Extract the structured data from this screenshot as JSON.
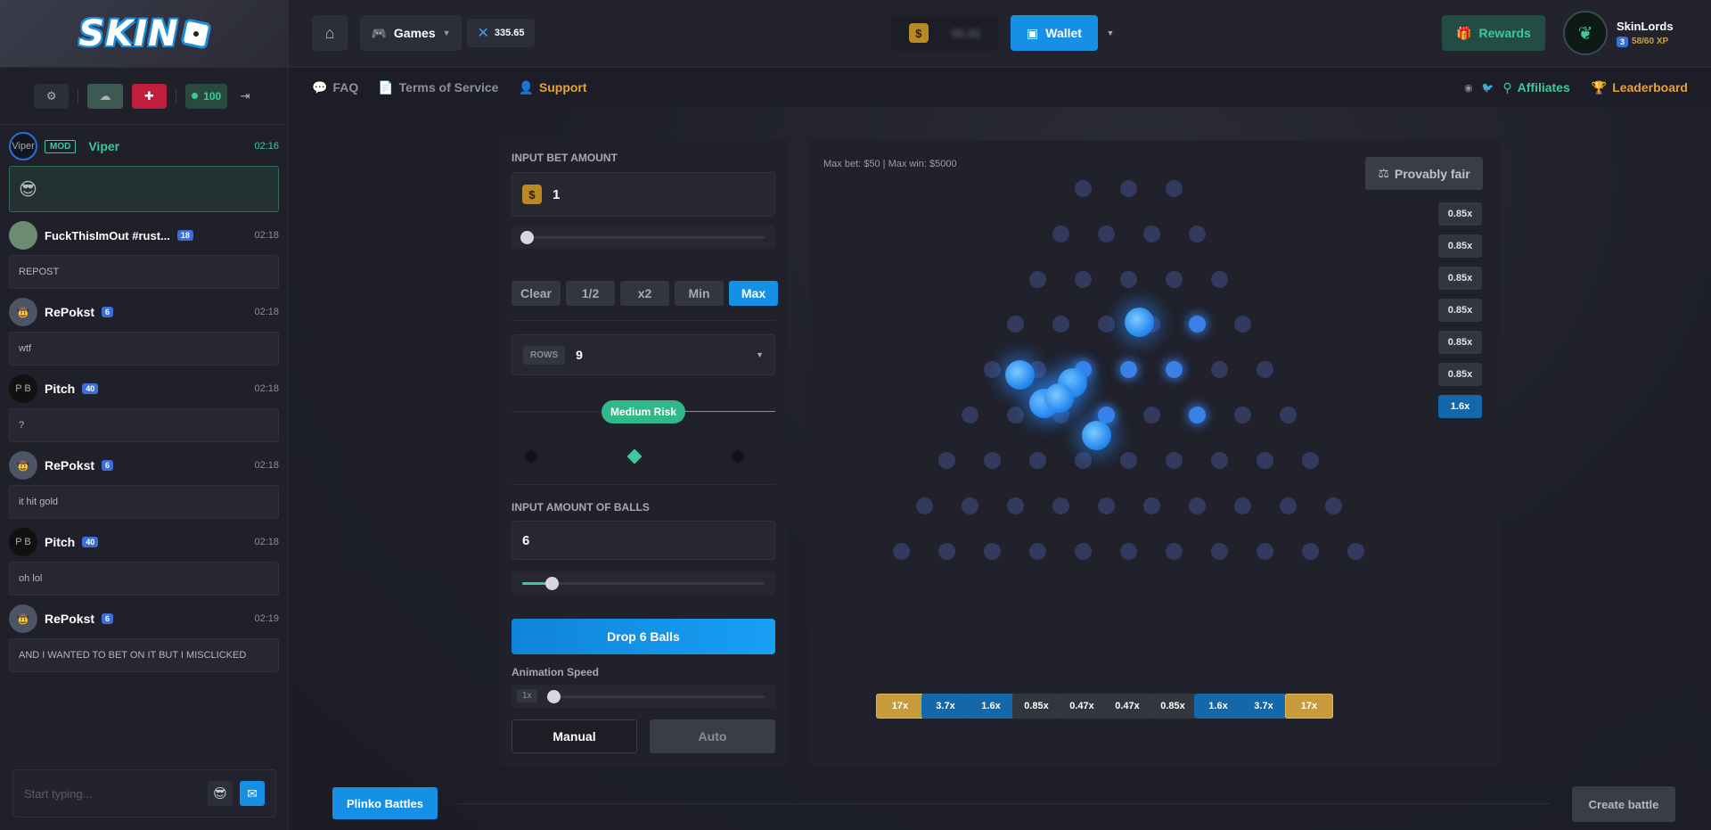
{
  "header": {
    "games_label": "Games",
    "balance_points": "335.65",
    "wallet_balance": "96.42",
    "wallet_label": "Wallet",
    "rewards_label": "Rewards",
    "username": "SkinLords",
    "level": "3",
    "xp": "58/60 XP"
  },
  "subnav": {
    "faq": "FAQ",
    "tos": "Terms of Service",
    "support": "Support",
    "affiliates": "Affiliates",
    "leaderboard": "Leaderboard"
  },
  "sidebar": {
    "online_count": "100",
    "messages": [
      {
        "name": "Viper",
        "time": "02:16",
        "badge": "MOD",
        "text": ""
      },
      {
        "name": "FuckThisImOut #rust...",
        "time": "02:18",
        "badge": "18",
        "text": "REPOST"
      },
      {
        "name": "RePokst",
        "time": "02:18",
        "badge": "6",
        "text": "wtf"
      },
      {
        "name": "Pitch",
        "time": "02:18",
        "badge": "40",
        "text": "?"
      },
      {
        "name": "RePokst",
        "time": "02:18",
        "badge": "6",
        "text": "it hit gold"
      },
      {
        "name": "Pitch",
        "time": "02:18",
        "badge": "40",
        "text": "oh lol"
      },
      {
        "name": "RePokst",
        "time": "02:19",
        "badge": "6",
        "text": "AND I WANTED TO BET ON IT BUT I MISCLICKED"
      }
    ],
    "input_placeholder": "Start typing..."
  },
  "controls": {
    "bet_label": "INPUT BET AMOUNT",
    "bet_value": "1",
    "bet_slider_fraction": 0.02,
    "quick_buttons": [
      "Clear",
      "1/2",
      "x2",
      "Min",
      "Max"
    ],
    "rows_tag": "ROWS",
    "rows_value": "9",
    "risk_label": "Medium Risk",
    "balls_label": "INPUT AMOUNT OF BALLS",
    "balls_value": "6",
    "balls_slider_fraction": 0.12,
    "drop_label": "Drop 6 Balls",
    "speed_label": "Animation Speed",
    "speed_value": "1x",
    "manual_label": "Manual",
    "auto_label": "Auto"
  },
  "board": {
    "info": "Max bet: $50 | Max win: $5000",
    "fair_label": "Provably fair",
    "history": [
      "0.85x",
      "0.85x",
      "0.85x",
      "0.85x",
      "0.85x",
      "0.85x",
      "1.6x"
    ],
    "buckets": [
      "17x",
      "3.7x",
      "1.6x",
      "0.85x",
      "0.47x",
      "0.47x",
      "0.85x",
      "1.6x",
      "3.7x",
      "17x"
    ]
  },
  "footer": {
    "battles_label": "Plinko Battles",
    "create_label": "Create battle"
  }
}
